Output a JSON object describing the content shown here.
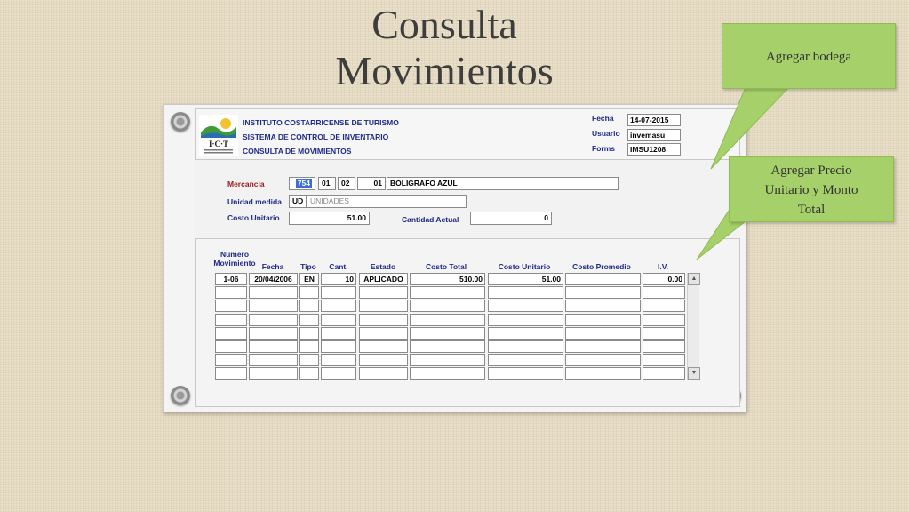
{
  "slide": {
    "title_line1": "Consulta",
    "title_line2": "Movimientos"
  },
  "header": {
    "org": "INSTITUTO COSTARRICENSE DE TURISMO",
    "system": "SISTEMA DE CONTROL DE INVENTARIO",
    "screen": "CONSULTA DE MOVIMIENTOS",
    "logo_text": "I·C·T",
    "fecha_label": "Fecha",
    "fecha_value": "14-07-2015",
    "usuario_label": "Usuario",
    "usuario_value": "invemasu",
    "forms_label": "Forms",
    "forms_value": "IMSU1208"
  },
  "form": {
    "mercancia_label": "Mercancia",
    "mercancia_code": "754",
    "mercancia_f2": "01",
    "mercancia_f3": "02",
    "mercancia_f4": "01",
    "mercancia_desc": "BOLIGRAFO AZUL",
    "unidad_label": "Unidad medida",
    "unidad_code": "UD",
    "unidad_desc": "UNIDADES",
    "costo_label": "Costo Unitario",
    "costo_value": "51.00",
    "cantidad_label": "Cantidad Actual",
    "cantidad_value": "0"
  },
  "table": {
    "headers": {
      "numero": "Número",
      "movimiento": "Movimiento",
      "fecha": "Fecha",
      "tipo": "Tipo",
      "cant": "Cant.",
      "estado": "Estado",
      "costo_total": "Costo Total",
      "costo_unitario": "Costo Unitario",
      "costo_promedio": "Costo Promedio",
      "iv": "I.V."
    },
    "rows": [
      {
        "mov": "1-06",
        "fecha": "20/04/2006",
        "tipo": "EN",
        "cant": "10",
        "estado": "APLICADO",
        "total": "510.00",
        "unit": "51.00",
        "prom": "",
        "iv": "0.00"
      }
    ]
  },
  "callouts": {
    "bodega": "Agregar bodega",
    "precio_line1": "Agregar Precio",
    "precio_line2": "Unitario y Monto",
    "precio_line3": "Total"
  },
  "colors": {
    "callout_fill": "#a6d069",
    "label_blue": "#1f2a8a",
    "label_red": "#9c1a1a",
    "selection": "#3a6fcf"
  },
  "icons": [
    "screw-icon",
    "scroll-up-icon",
    "scroll-down-icon",
    "ict-logo"
  ]
}
